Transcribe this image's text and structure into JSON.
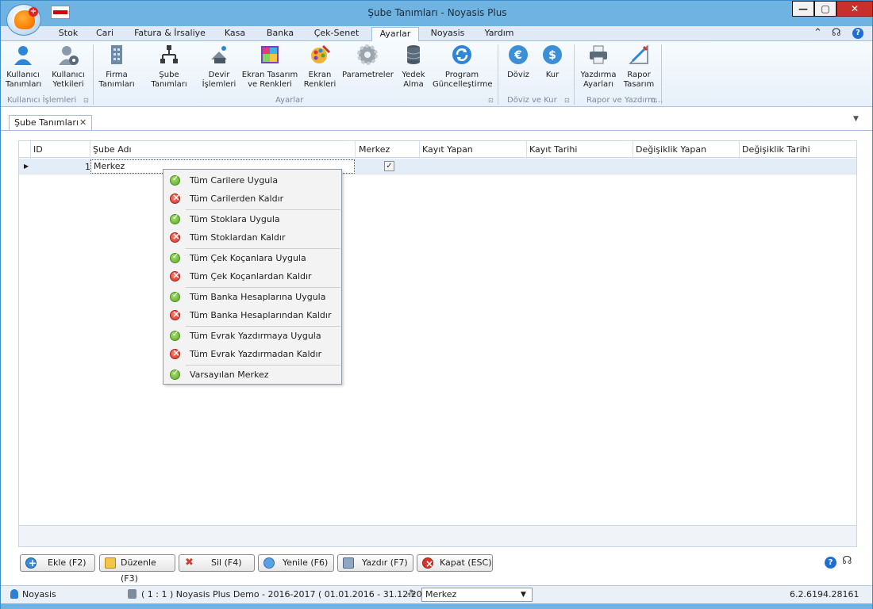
{
  "window": {
    "title": "Şube Tanımları - Noyasis Plus",
    "controls": {
      "minimize": "—",
      "maximize": "▢",
      "close": "✕"
    }
  },
  "ribbon_tabs": [
    {
      "label": "Stok"
    },
    {
      "label": "Cari"
    },
    {
      "label": "Fatura & İrsaliye"
    },
    {
      "label": "Kasa"
    },
    {
      "label": "Banka"
    },
    {
      "label": "Çek-Senet"
    },
    {
      "label": "Ayarlar"
    },
    {
      "label": "Noyasis"
    },
    {
      "label": "Yardım"
    }
  ],
  "active_tab": "Ayarlar",
  "ribbon": {
    "buttons": [
      {
        "line1": "Kullanıcı",
        "line2": "Tanımları",
        "icon": "user-icon"
      },
      {
        "line1": "Kullanıcı",
        "line2": "Yetkileri",
        "icon": "user-permissions-icon"
      },
      {
        "line1": "Firma",
        "line2": "Tanımları",
        "icon": "building-icon"
      },
      {
        "line1": "Şube Tanımları",
        "line2": "",
        "icon": "org-chart-icon"
      },
      {
        "line1": "Devir",
        "line2": "İşlemleri",
        "icon": "transfer-icon"
      },
      {
        "line1": "Ekran Tasarım",
        "line2": "ve Renkleri",
        "icon": "screen-design-icon"
      },
      {
        "line1": "Ekran",
        "line2": "Renkleri",
        "icon": "palette-icon"
      },
      {
        "line1": "Parametreler",
        "line2": "",
        "icon": "gear-icon"
      },
      {
        "line1": "Yedek",
        "line2": "Alma",
        "icon": "database-icon"
      },
      {
        "line1": "Program",
        "line2": "Güncelleştirme",
        "icon": "update-icon"
      },
      {
        "line1": "Döviz",
        "line2": "",
        "icon": "euro-icon"
      },
      {
        "line1": "Kur",
        "line2": "",
        "icon": "dollar-icon"
      },
      {
        "line1": "Yazdırma",
        "line2": "Ayarları",
        "icon": "printer-icon"
      },
      {
        "line1": "Rapor",
        "line2": "Tasarım",
        "icon": "report-design-icon"
      }
    ],
    "groups": {
      "kullanici": "Kullanıcı İşlemleri",
      "ayarlar": "Ayarlar",
      "doviz": "Döviz ve Kur",
      "rapor": "Rapor ve Yazdırm..."
    }
  },
  "document_tab": {
    "label": "Şube Tanımları",
    "close": "✕"
  },
  "grid": {
    "columns": [
      "ID",
      "Şube Adı",
      "Merkez",
      "Kayıt Yapan",
      "Kayıt Tarihi",
      "Değişiklik Yapan",
      "Değişiklik Tarihi"
    ],
    "rows": [
      {
        "id": "1",
        "sube_adi": "Merkez",
        "merkez": true,
        "kayit_yapan": "",
        "kayit_tarihi": "",
        "degisiklik_yapan": "",
        "degisiklik_tarihi": ""
      }
    ]
  },
  "context_menu": [
    {
      "label": "Tüm Carilere Uygula",
      "type": "apply"
    },
    {
      "label": "Tüm Carilerden Kaldır",
      "type": "remove"
    },
    {
      "label": "Tüm Stoklara Uygula",
      "type": "apply"
    },
    {
      "label": "Tüm Stoklardan Kaldır",
      "type": "remove"
    },
    {
      "label": "Tüm Çek Koçanlara Uygula",
      "type": "apply"
    },
    {
      "label": "Tüm Çek Koçanlardan Kaldır",
      "type": "remove"
    },
    {
      "label": "Tüm Banka Hesaplarına Uygula",
      "type": "apply"
    },
    {
      "label": "Tüm Banka Hesaplarından Kaldır",
      "type": "remove"
    },
    {
      "label": "Tüm Evrak Yazdırmaya Uygula",
      "type": "apply"
    },
    {
      "label": "Tüm Evrak Yazdırmadan Kaldır",
      "type": "remove"
    },
    {
      "label": "Varsayılan Merkez",
      "type": "apply"
    }
  ],
  "actions": {
    "add": "Ekle (F2)",
    "edit": "Düzenle (F3)",
    "delete": "Sil (F4)",
    "refresh": "Yenile (F6)",
    "print": "Yazdır (F7)",
    "close": "Kapat (ESC)"
  },
  "status_bar": {
    "user": "Noyasis",
    "database": "( 1 : 1 )  Noyasis Plus Demo - 2016-2017  ( 01.01.2016 - 31.12.2017 )",
    "branch": "Merkez",
    "version": "6.2.6194.28161"
  },
  "colors": {
    "title_bar": "#6fb3e2",
    "selected_row": "#e2edf8",
    "apply_icon": "#5aa628",
    "remove_icon": "#d9342a"
  }
}
